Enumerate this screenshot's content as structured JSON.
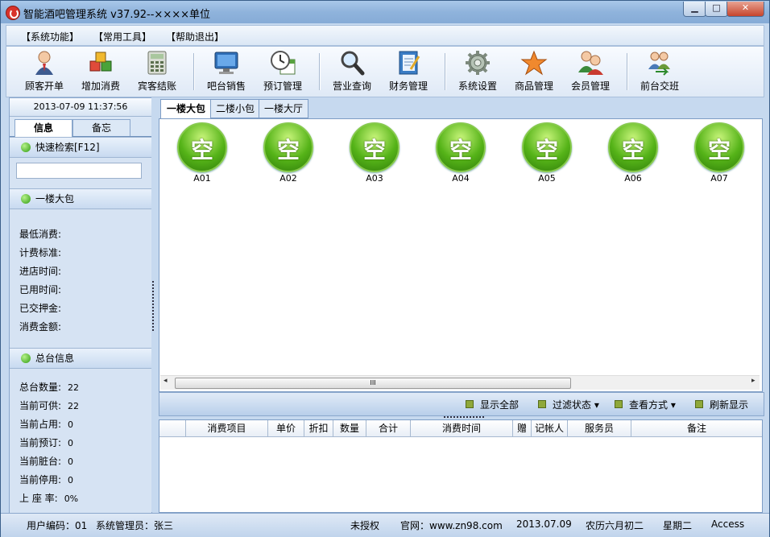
{
  "window": {
    "title": "智能酒吧管理系统 v37.92--××××单位",
    "minimize": "▁",
    "maximize": "□",
    "close": "✕"
  },
  "menu": [
    "【系统功能】",
    "【常用工具】",
    "【帮助退出】"
  ],
  "toolbar": [
    {
      "label": "顾客开单",
      "icon": "customer-icon"
    },
    {
      "label": "增加消费",
      "icon": "cubes-icon"
    },
    {
      "label": "宾客结账",
      "icon": "calculator-icon"
    },
    {
      "label": "吧台销售",
      "icon": "monitor-icon"
    },
    {
      "label": "预订管理",
      "icon": "clock-calendar-icon"
    },
    {
      "label": "营业查询",
      "icon": "magnifier-icon"
    },
    {
      "label": "财务管理",
      "icon": "notebook-icon"
    },
    {
      "label": "系统设置",
      "icon": "gear-icon"
    },
    {
      "label": "商品管理",
      "icon": "star-icon"
    },
    {
      "label": "会员管理",
      "icon": "users-icon"
    },
    {
      "label": "前台交班",
      "icon": "shift-change-icon"
    }
  ],
  "left": {
    "datetime": "2013-07-09 11:37:56",
    "tabs": [
      "信息",
      "备忘"
    ],
    "quick_search": "快速检索[F12]",
    "search_value": "",
    "room_section": "一楼大包",
    "room_fields": [
      "最低消费:",
      "计费标准:",
      "进店时间:",
      "已用时间:",
      "已交押金:",
      "消费金额:"
    ],
    "summary_section": "总台信息",
    "summary": [
      {
        "label": "总台数量:",
        "value": "22"
      },
      {
        "label": "当前可供:",
        "value": "22"
      },
      {
        "label": "当前占用:",
        "value": "0"
      },
      {
        "label": "当前预订:",
        "value": "0"
      },
      {
        "label": "当前脏台:",
        "value": "0"
      },
      {
        "label": "当前停用:",
        "value": "0"
      },
      {
        "label": "上 座 率:",
        "value": "0%"
      }
    ]
  },
  "main_tabs": [
    "一楼大包",
    "二楼小包",
    "一楼大厅"
  ],
  "rooms": [
    {
      "code": "A01",
      "status": "空"
    },
    {
      "code": "A02",
      "status": "空"
    },
    {
      "code": "A03",
      "status": "空"
    },
    {
      "code": "A04",
      "status": "空"
    },
    {
      "code": "A05",
      "status": "空"
    },
    {
      "code": "A06",
      "status": "空"
    },
    {
      "code": "A07",
      "status": "空"
    }
  ],
  "scroll": {
    "thumb": "III",
    "left": "◂",
    "right": "▸"
  },
  "actions": [
    "显示全部",
    "过滤状态 ▾",
    "查看方式 ▾",
    "刷新显示"
  ],
  "grid_columns": [
    "消费项目",
    "单价",
    "折扣",
    "数量",
    "合计",
    "消费时间",
    "赠",
    "记帐人",
    "服务员",
    "备注"
  ],
  "status": {
    "user": "用户编码：01",
    "admin": "系统管理员：张三",
    "license": "未授权",
    "site": "官网：www.zn98.com",
    "date": "2013.07.09",
    "lunar": "农历六月初二",
    "weekday": "星期二",
    "db": "Access"
  }
}
